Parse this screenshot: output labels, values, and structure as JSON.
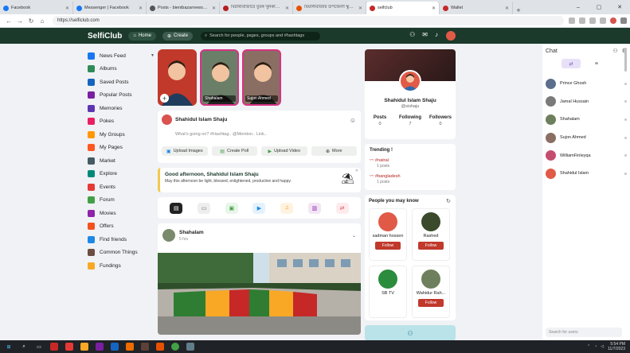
{
  "browser": {
    "tabs": [
      {
        "title": "Facebook",
        "color": "#1877f2",
        "active": false
      },
      {
        "title": "Messenger | Facebook",
        "color": "#1877f2",
        "active": false
      },
      {
        "title": "Posts - bienibazarnews24 — WordPress",
        "color": "#555555",
        "active": false
      },
      {
        "title": "বিরামীবাজারে যুবক খুনকাণ্ডে পাঁচ",
        "color": "#b71c1c",
        "active": false
      },
      {
        "title": "বিয়ানীবাজার উপজেলা স্কুলে ভিপিগ্রুপে",
        "color": "#e65100",
        "active": false
      },
      {
        "title": "selfclub",
        "color": "#c62828",
        "active": true
      },
      {
        "title": "Wallet",
        "color": "#c62828",
        "active": false
      }
    ],
    "new_tab": "+",
    "url": "https://selficlub.com"
  },
  "header": {
    "logo": "SelfiClub",
    "home_label": "Home",
    "create_label": "Create",
    "search_placeholder": "Search for people, pages, groups and #hashtags"
  },
  "sidebar": {
    "items": [
      {
        "label": "News Feed",
        "icon": "newsfeed-icon",
        "color": "#1877f2",
        "chevron": true
      },
      {
        "label": "Albums",
        "icon": "album-icon",
        "color": "#2e8b57"
      },
      {
        "label": "Saved Posts",
        "icon": "bookmark-icon",
        "color": "#1565c0"
      },
      {
        "label": "Popular Posts",
        "icon": "popular-icon",
        "color": "#7b1fa2"
      },
      {
        "label": "Memories",
        "icon": "memories-icon",
        "color": "#5e35b1"
      },
      {
        "label": "Pokes",
        "icon": "poke-icon",
        "color": "#e91e63"
      },
      {
        "label": "My Groups",
        "icon": "groups-icon",
        "color": "#ff9800"
      },
      {
        "label": "My Pages",
        "icon": "pages-icon",
        "color": "#ff5722"
      },
      {
        "label": "Market",
        "icon": "market-icon",
        "color": "#455a64"
      },
      {
        "label": "Explore",
        "icon": "explore-icon",
        "color": "#00897b"
      },
      {
        "label": "Events",
        "icon": "events-icon",
        "color": "#e53935"
      },
      {
        "label": "Forum",
        "icon": "forum-icon",
        "color": "#43a047"
      },
      {
        "label": "Movies",
        "icon": "movies-icon",
        "color": "#8e24aa"
      },
      {
        "label": "Offers",
        "icon": "offers-icon",
        "color": "#f4511e"
      },
      {
        "label": "Find friends",
        "icon": "find-friends-icon",
        "color": "#1e88e5"
      },
      {
        "label": "Common Things",
        "icon": "common-things-icon",
        "color": "#6d4c41"
      },
      {
        "label": "Fundings",
        "icon": "fundings-icon",
        "color": "#f9a825"
      }
    ]
  },
  "stories": [
    {
      "name": "",
      "bg": "#c0392b",
      "is_add": true
    },
    {
      "name": "Shahalam",
      "bg": "#6b7f68",
      "is_add": false
    },
    {
      "name": "Sujon Ahmed",
      "bg": "#8a6e63",
      "is_add": false
    }
  ],
  "composer": {
    "user": "Shahidul Islam Shaju",
    "placeholder": "What's going on? #Hashtag.. @Mention.. Link..",
    "actions": [
      "Upload Images",
      "Create Poll",
      "Upload Video",
      "More"
    ]
  },
  "greeting": {
    "title": "Good afternoon, Shahidul Islam Shaju",
    "subtitle": "May this afternoon be light, blessed, enlightened, productive and happy."
  },
  "filters": [
    {
      "icon": "all-posts-icon",
      "color": "#333333",
      "bg": "#222222"
    },
    {
      "icon": "text-posts-icon",
      "color": "#666666",
      "bg": "#eeeeee"
    },
    {
      "icon": "photos-icon",
      "color": "#43a047",
      "bg": "#e8f5e9"
    },
    {
      "icon": "videos-icon",
      "color": "#1e88e5",
      "bg": "#e3f2fd"
    },
    {
      "icon": "music-icon",
      "color": "#fb8c00",
      "bg": "#fff3e0"
    },
    {
      "icon": "files-icon",
      "color": "#8e24aa",
      "bg": "#f3e5f5"
    },
    {
      "icon": "shares-icon",
      "color": "#e53935",
      "bg": "#ffebee"
    }
  ],
  "post": {
    "author": "Shahalam",
    "time": "5 hrs"
  },
  "profile": {
    "name": "Shahidul Islam Shaju",
    "handle": "@sishaju",
    "stats": [
      {
        "label": "Posts",
        "value": "0"
      },
      {
        "label": "Following",
        "value": "7"
      },
      {
        "label": "Followers",
        "value": "0"
      }
    ]
  },
  "trending": {
    "title": "Trending !",
    "tags": [
      {
        "tag": "#natral",
        "count": "1 posts"
      },
      {
        "tag": "#bangladesh",
        "count": "1 posts"
      }
    ]
  },
  "suggestions": {
    "title": "People you may know",
    "follow_label": "Follow",
    "people": [
      {
        "name": "sadman hossen",
        "color": "#e05a47",
        "follow": true
      },
      {
        "name": "Rashed",
        "color": "#3a4a2a",
        "follow": true
      },
      {
        "name": "SB TV",
        "color": "#2a8c3c",
        "follow": false
      },
      {
        "name": "Wahidur Rah...",
        "color": "#6d7f5c",
        "follow": true
      }
    ]
  },
  "chat": {
    "title": "Chat",
    "search_placeholder": "Search for users",
    "users": [
      {
        "name": "Prince Ghosh",
        "color": "#5b6f8c"
      },
      {
        "name": "Jamal Hussain",
        "color": "#7a7a7a"
      },
      {
        "name": "Shahalam",
        "color": "#6d7f5c"
      },
      {
        "name": "Sujon Ahmed",
        "color": "#8a6e63"
      },
      {
        "name": "WilliamFinleyqa",
        "color": "#c44d6e"
      },
      {
        "name": "Shahidul Islam",
        "color": "#e05a47"
      }
    ]
  },
  "taskbar": {
    "time": "5:54 PM",
    "date": "11/7/2023"
  }
}
